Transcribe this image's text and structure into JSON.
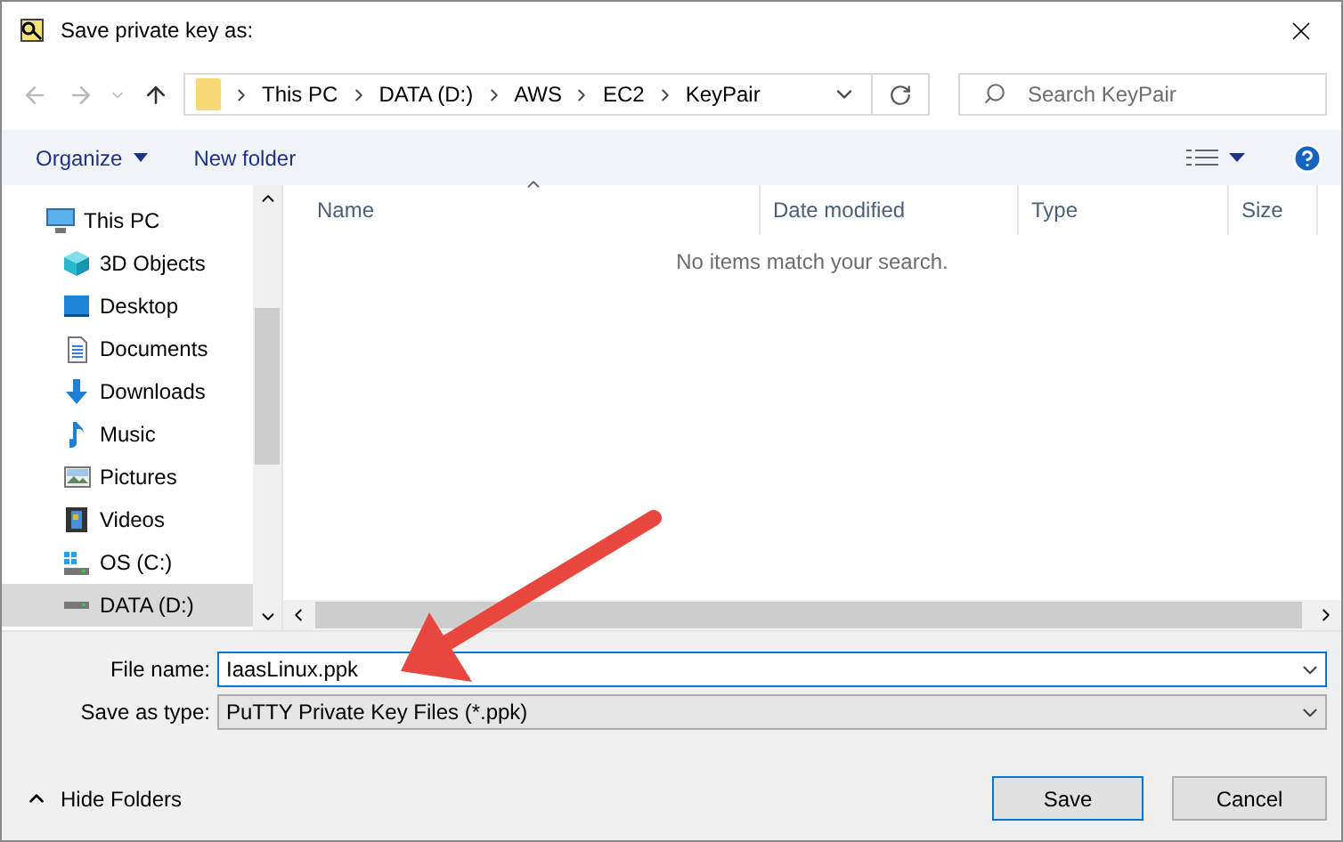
{
  "window": {
    "title": "Save private key as:"
  },
  "address": {
    "crumbs": [
      "This PC",
      "DATA (D:)",
      "AWS",
      "EC2",
      "KeyPair"
    ]
  },
  "search": {
    "placeholder": "Search KeyPair"
  },
  "toolbar": {
    "organize": "Organize",
    "new_folder": "New folder"
  },
  "sidebar": {
    "items": [
      {
        "label": "This PC",
        "kind": "computer",
        "selected": false,
        "children": [
          {
            "label": "3D Objects",
            "kind": "cube",
            "selected": false
          },
          {
            "label": "Desktop",
            "kind": "desktop",
            "selected": false
          },
          {
            "label": "Documents",
            "kind": "documents",
            "selected": false
          },
          {
            "label": "Downloads",
            "kind": "download",
            "selected": false
          },
          {
            "label": "Music",
            "kind": "music",
            "selected": false
          },
          {
            "label": "Pictures",
            "kind": "pictures",
            "selected": false
          },
          {
            "label": "Videos",
            "kind": "videos",
            "selected": false
          },
          {
            "label": "OS (C:)",
            "kind": "osdrive",
            "selected": false
          },
          {
            "label": "DATA (D:)",
            "kind": "drive",
            "selected": true
          }
        ]
      }
    ]
  },
  "table": {
    "columns": [
      "Name",
      "Date modified",
      "Type",
      "Size"
    ],
    "empty_message": "No items match your search."
  },
  "form": {
    "file_name_label": "File name:",
    "file_name": "IaasLinux.ppk",
    "type_label": "Save as type:",
    "type_value": "PuTTY Private Key Files (*.ppk)"
  },
  "hide_folders": "Hide Folders",
  "buttons": [
    "Save",
    "Cancel"
  ]
}
